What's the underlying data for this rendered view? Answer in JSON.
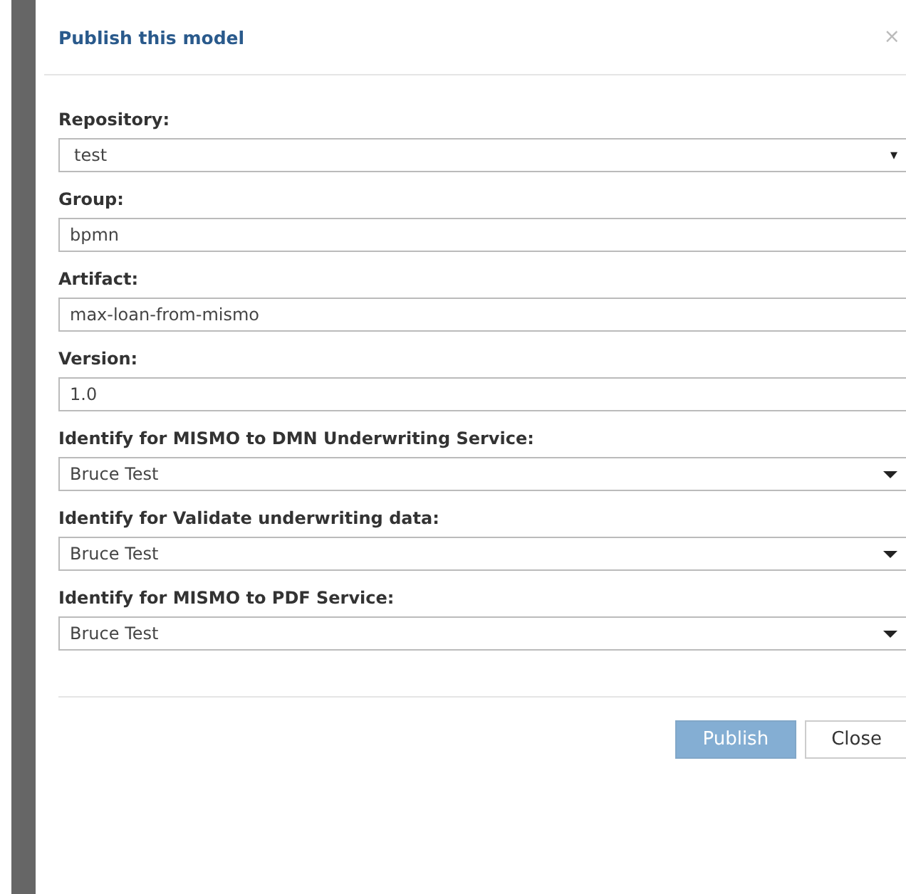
{
  "dialog": {
    "title": "Publish this model",
    "close_icon": "×"
  },
  "fields": [
    {
      "kind": "select",
      "label": "Repository:",
      "value": "test",
      "arrow": "▾"
    },
    {
      "kind": "input",
      "label": "Group:",
      "value": "bpmn"
    },
    {
      "kind": "input",
      "label": "Artifact:",
      "value": "max-loan-from-mismo"
    },
    {
      "kind": "input",
      "label": "Version:",
      "value": "1.0"
    },
    {
      "kind": "dropdown",
      "label": "Identify for MISMO to DMN Underwriting Service:",
      "value": "Bruce Test"
    },
    {
      "kind": "dropdown",
      "label": "Identify for Validate underwriting data:",
      "value": "Bruce Test"
    },
    {
      "kind": "dropdown",
      "label": "Identify for MISMO to PDF Service:",
      "value": "Bruce Test"
    }
  ],
  "buttons": [
    {
      "label": "Publish",
      "kind": "primary",
      "disabled": true
    },
    {
      "label": "Close",
      "kind": "default",
      "disabled": false
    }
  ]
}
